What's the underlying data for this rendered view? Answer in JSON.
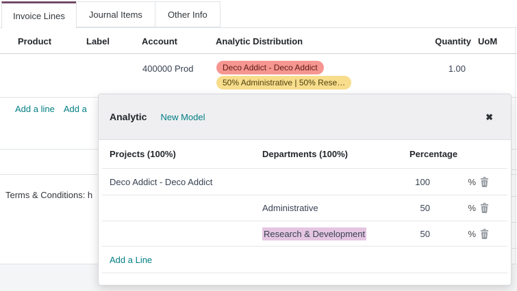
{
  "tabs": [
    {
      "label": "Invoice Lines",
      "active": true
    },
    {
      "label": "Journal Items",
      "active": false
    },
    {
      "label": "Other Info",
      "active": false
    }
  ],
  "invoice_table": {
    "headers": {
      "product": "Product",
      "label": "Label",
      "account": "Account",
      "analytic_distribution": "Analytic Distribution",
      "quantity": "Quantity",
      "uom": "UoM"
    },
    "row": {
      "account": "400000 Prod",
      "analytic_tags": [
        {
          "label": "Deco Addict - Deco Addict",
          "bg": "#f69691"
        },
        {
          "label": "50% Administrative | 50% Rese…",
          "bg": "#f7dd8c"
        }
      ],
      "quantity": "1.00"
    },
    "add_line_label": "Add a line",
    "add_partial_label": "Add a"
  },
  "terms_text": "Terms & Conditions: h",
  "popup": {
    "title": "Analytic",
    "new_model_label": "New Model",
    "close_icon": "✖",
    "columns": {
      "projects": "Projects (100%)",
      "departments": "Departments (100%)",
      "percentage": "Percentage"
    },
    "rows": [
      {
        "project": "Deco Addict - Deco Addict",
        "department": "",
        "percentage": "100",
        "highlighted": false
      },
      {
        "project": "",
        "department": "Administrative",
        "percentage": "50",
        "highlighted": false
      },
      {
        "project": "",
        "department": "Research & Development",
        "percentage": "50",
        "highlighted": true
      }
    ],
    "percent_sign": "%",
    "add_line_label": "Add a Line"
  },
  "colors": {
    "accent_teal": "#017e84",
    "active_tab_purple": "#714b67",
    "highlight_plum": "#e5c6e2",
    "tag_red_bg": "#f69691",
    "tag_yellow_bg": "#f7dd8c",
    "popup_header_bg": "#efeff1",
    "footer_bg": "#f4f5f7"
  }
}
